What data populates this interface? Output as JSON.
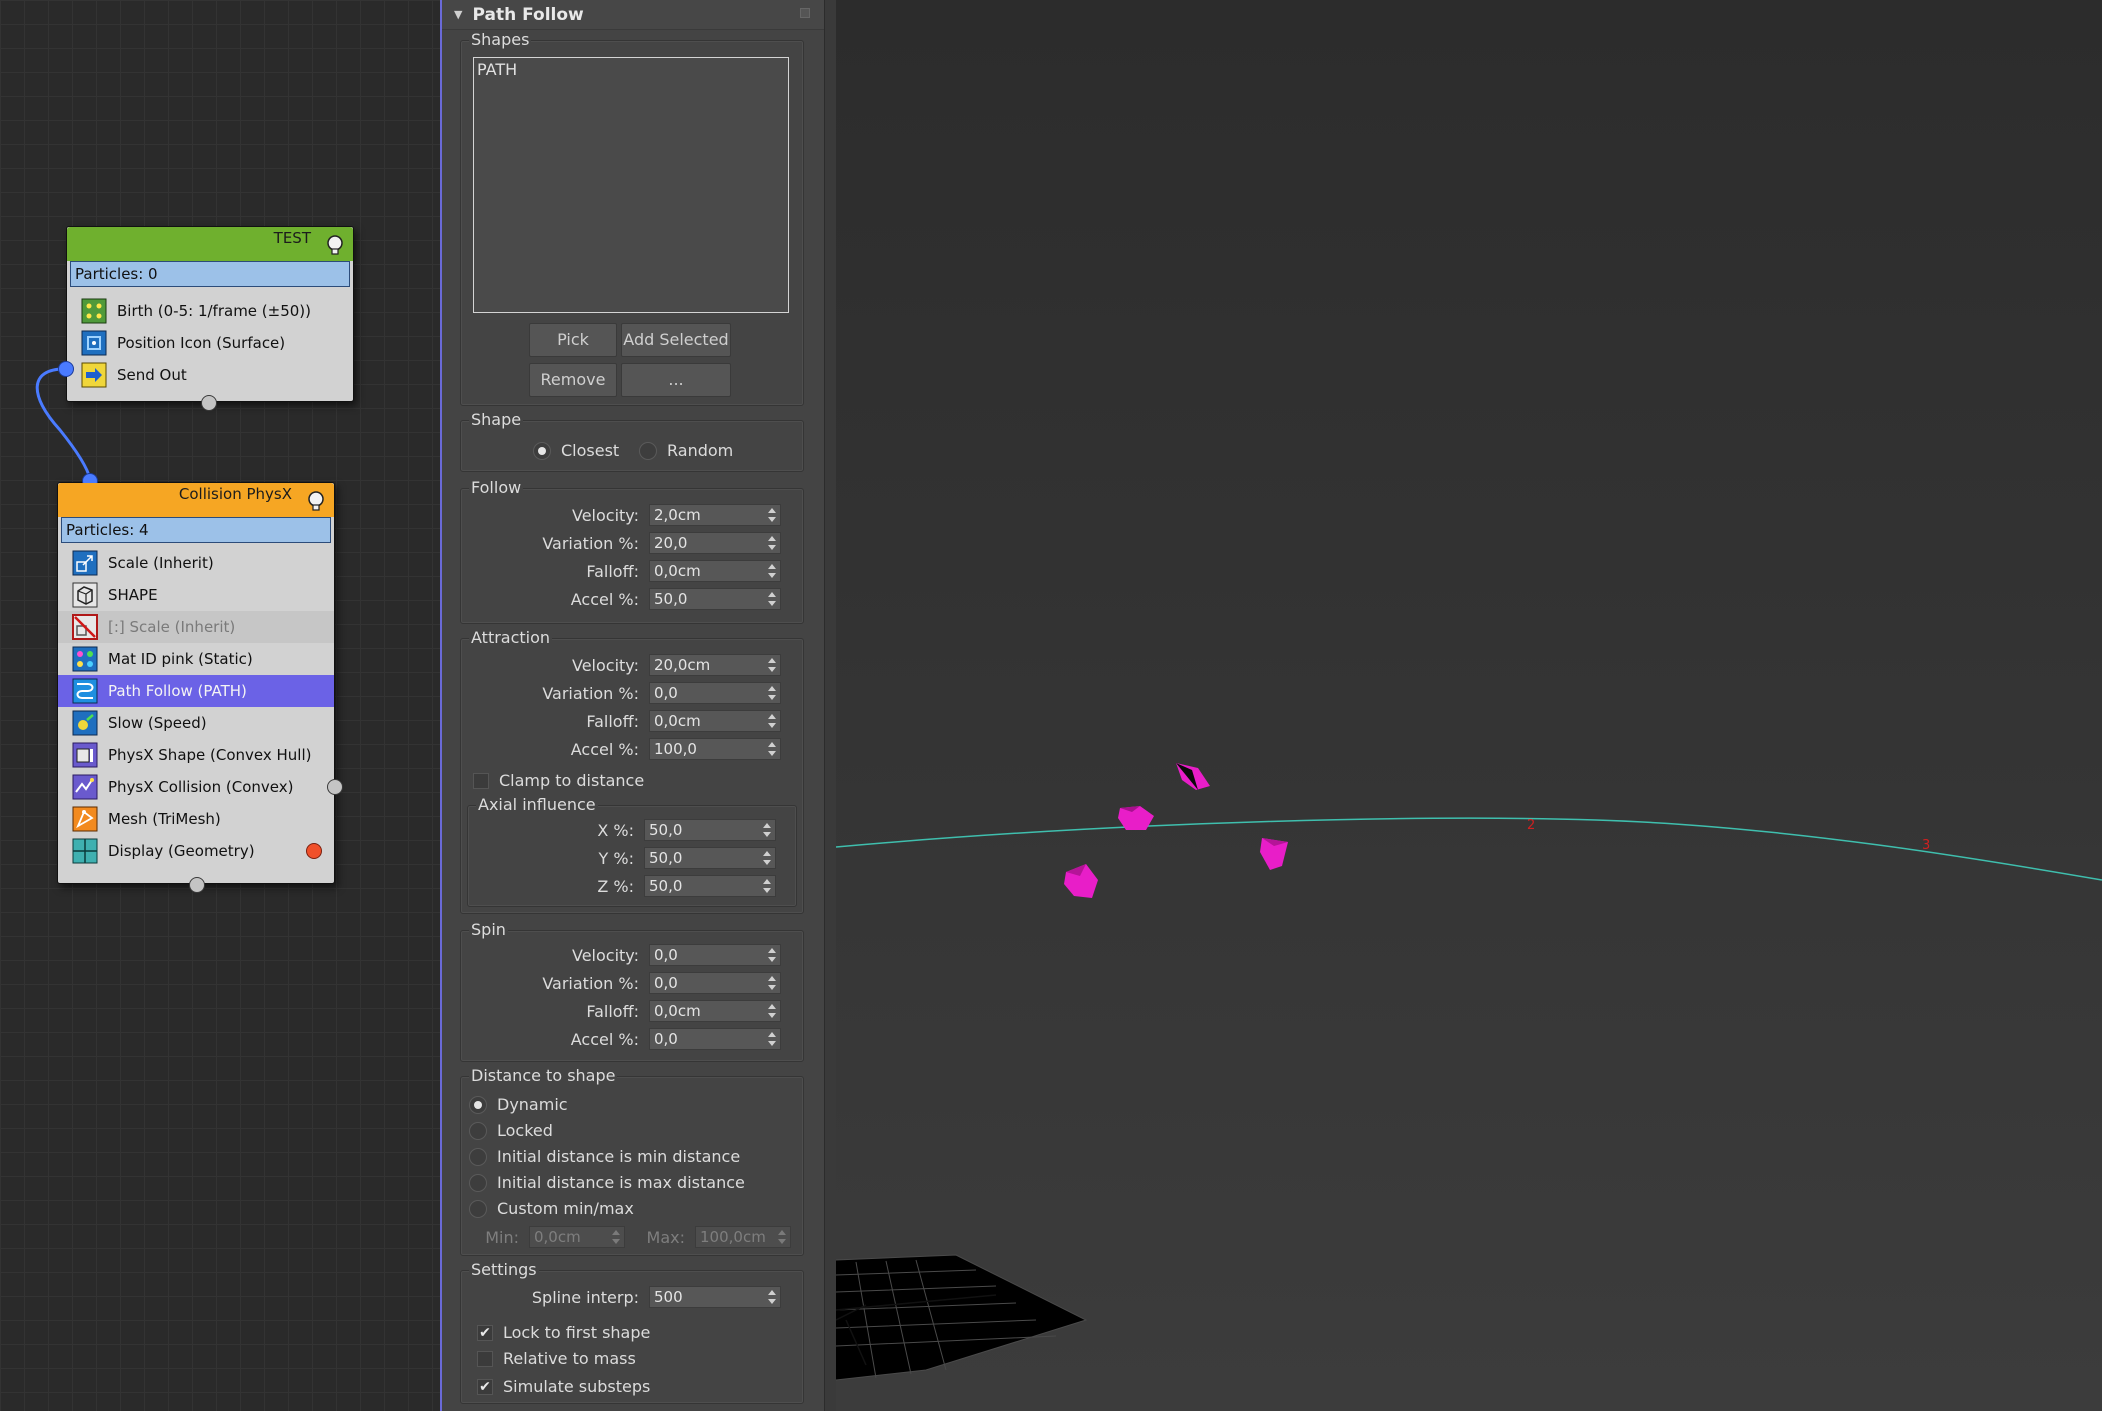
{
  "node_editor": {
    "nodes": {
      "test": {
        "title": "TEST",
        "header_color": "#6fb02e",
        "particles": "Particles: 0",
        "operators": [
          {
            "label": "Birth (0-5: 1/frame (±50))",
            "icon": "birth-icon"
          },
          {
            "label": "Position Icon (Surface)",
            "icon": "position-icon"
          },
          {
            "label": "Send Out",
            "icon": "send-out-icon"
          }
        ]
      },
      "collision": {
        "title": "Collision PhysX",
        "header_color": "#f6a623",
        "particles": "Particles: 4",
        "operators": [
          {
            "label": "Scale (Inherit)",
            "icon": "scale-icon"
          },
          {
            "label": "SHAPE",
            "icon": "shape-icon"
          },
          {
            "label": "[:] Scale (Inherit)",
            "icon": "scale-disabled-icon",
            "disabled": true
          },
          {
            "label": "Mat ID pink (Static)",
            "icon": "material-id-icon"
          },
          {
            "label": "Path Follow (PATH)",
            "icon": "path-follow-icon",
            "selected": true
          },
          {
            "label": "Slow (Speed)",
            "icon": "slow-icon"
          },
          {
            "label": "PhysX Shape (Convex Hull)",
            "icon": "physx-shape-icon"
          },
          {
            "label": "PhysX Collision (Convex)",
            "icon": "physx-collision-icon"
          },
          {
            "label": "Mesh (TriMesh)",
            "icon": "mesh-icon"
          },
          {
            "label": "Display (Geometry)",
            "icon": "display-icon"
          }
        ]
      }
    }
  },
  "panel": {
    "title": "Path Follow",
    "shapes": {
      "label": "Shapes",
      "items": [
        "PATH"
      ],
      "buttons": {
        "pick": "Pick",
        "add_selected": "Add Selected",
        "remove": "Remove",
        "more": "..."
      }
    },
    "shape": {
      "label": "Shape",
      "options": [
        {
          "label": "Closest",
          "selected": true
        },
        {
          "label": "Random",
          "selected": false
        }
      ]
    },
    "follow": {
      "label": "Follow",
      "velocity": {
        "label": "Velocity:",
        "value": "2,0cm"
      },
      "variation": {
        "label": "Variation %:",
        "value": "20,0"
      },
      "falloff": {
        "label": "Falloff:",
        "value": "0,0cm"
      },
      "accel": {
        "label": "Accel %:",
        "value": "50,0"
      }
    },
    "attraction": {
      "label": "Attraction",
      "velocity": {
        "label": "Velocity:",
        "value": "20,0cm"
      },
      "variation": {
        "label": "Variation %:",
        "value": "0,0"
      },
      "falloff": {
        "label": "Falloff:",
        "value": "0,0cm"
      },
      "accel": {
        "label": "Accel %:",
        "value": "100,0"
      },
      "clamp": {
        "label": "Clamp to distance",
        "checked": false
      },
      "axial": {
        "label": "Axial influence",
        "x": {
          "label": "X %:",
          "value": "50,0"
        },
        "y": {
          "label": "Y %:",
          "value": "50,0"
        },
        "z": {
          "label": "Z %:",
          "value": "50,0"
        }
      }
    },
    "spin": {
      "label": "Spin",
      "velocity": {
        "label": "Velocity:",
        "value": "0,0"
      },
      "variation": {
        "label": "Variation %:",
        "value": "0,0"
      },
      "falloff": {
        "label": "Falloff:",
        "value": "0,0cm"
      },
      "accel": {
        "label": "Accel %:",
        "value": "0,0"
      }
    },
    "distance": {
      "label": "Distance to shape",
      "options": [
        {
          "label": "Dynamic",
          "selected": true
        },
        {
          "label": "Locked",
          "selected": false
        },
        {
          "label": "Initial distance is min distance",
          "selected": false
        },
        {
          "label": "Initial distance is max distance",
          "selected": false
        },
        {
          "label": "Custom min/max",
          "selected": false
        }
      ],
      "min": {
        "label": "Min:",
        "value": "0,0cm"
      },
      "max": {
        "label": "Max:",
        "value": "100,0cm"
      }
    },
    "settings": {
      "label": "Settings",
      "spline_interp": {
        "label": "Spline interp:",
        "value": "500"
      },
      "lock_first": {
        "label": "Lock to first shape",
        "checked": true
      },
      "relative_mass": {
        "label": "Relative to mass",
        "checked": false
      },
      "simulate_substeps": {
        "label": "Simulate substeps",
        "checked": true
      }
    }
  },
  "viewport": {
    "spline_labels": [
      "2",
      "3"
    ],
    "spline_color": "#3fbfae",
    "particle_color": "#e81ec8"
  }
}
